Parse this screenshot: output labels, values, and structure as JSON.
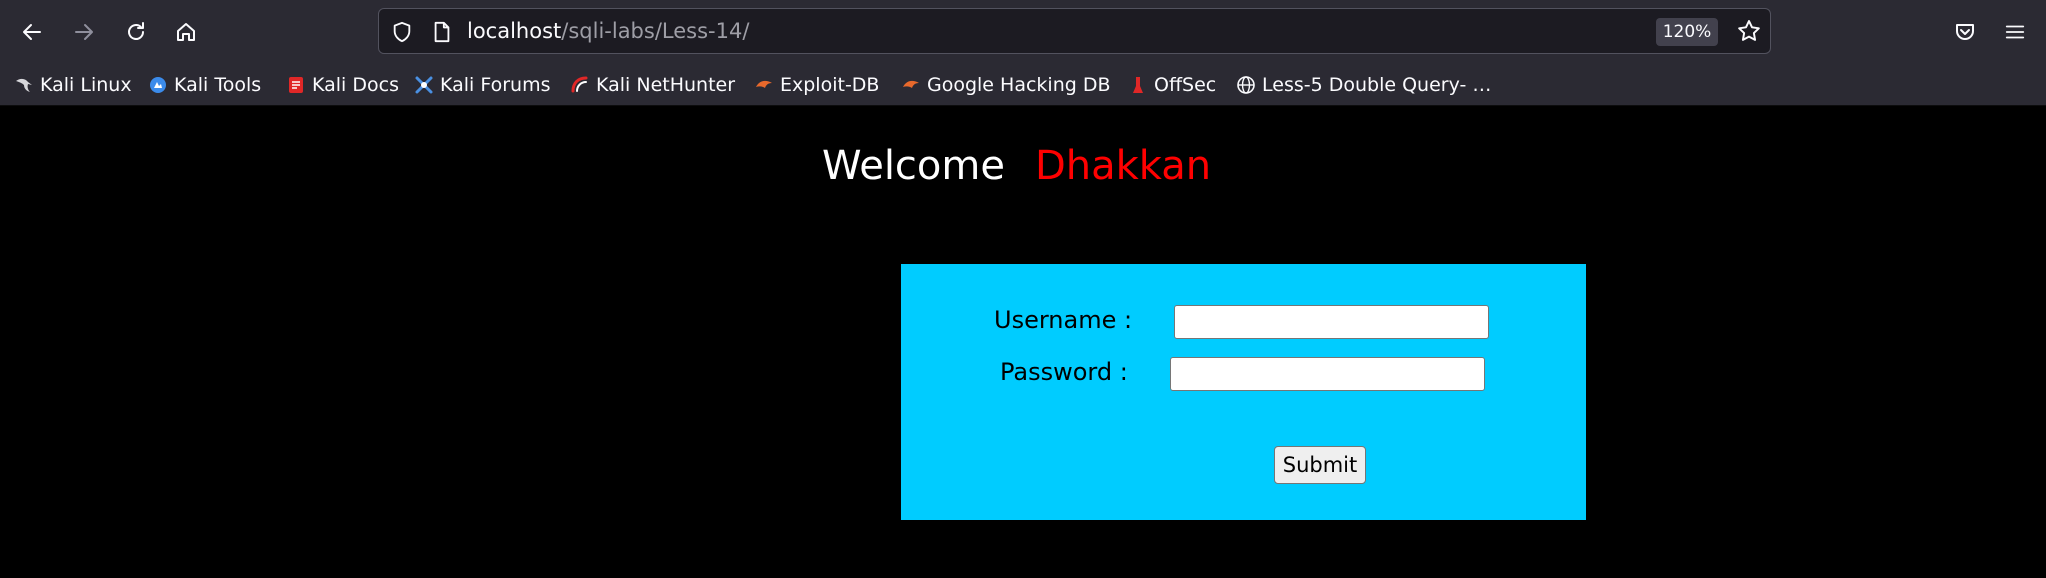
{
  "browser": {
    "url_host": "localhost",
    "url_path": "/sqli-labs/Less-14/",
    "zoom": "120%",
    "bookmarks": [
      {
        "label": "Kali Linux",
        "icon": "kali-dragon-icon"
      },
      {
        "label": "Kali Tools",
        "icon": "kali-tools-icon"
      },
      {
        "label": "Kali Docs",
        "icon": "kali-docs-icon"
      },
      {
        "label": "Kali Forums",
        "icon": "kali-forums-icon"
      },
      {
        "label": "Kali NetHunter",
        "icon": "nethunter-icon"
      },
      {
        "label": "Exploit-DB",
        "icon": "exploit-db-icon"
      },
      {
        "label": "Google Hacking DB",
        "icon": "ghdb-icon"
      },
      {
        "label": "OffSec",
        "icon": "offsec-icon"
      },
      {
        "label": "Less-5 Double Query- …",
        "icon": "globe-icon"
      }
    ]
  },
  "page": {
    "welcome": "Welcome",
    "name": "Dhakkan",
    "form": {
      "username_label": "Username :",
      "password_label": "Password :",
      "username_value": "",
      "password_value": "",
      "submit_label": "Submit"
    }
  },
  "colors": {
    "chrome": "#2b2a33",
    "url_field": "#1c1b22",
    "page_bg": "#000000",
    "form_bg": "#00ccff",
    "name_color": "#ff0000"
  }
}
